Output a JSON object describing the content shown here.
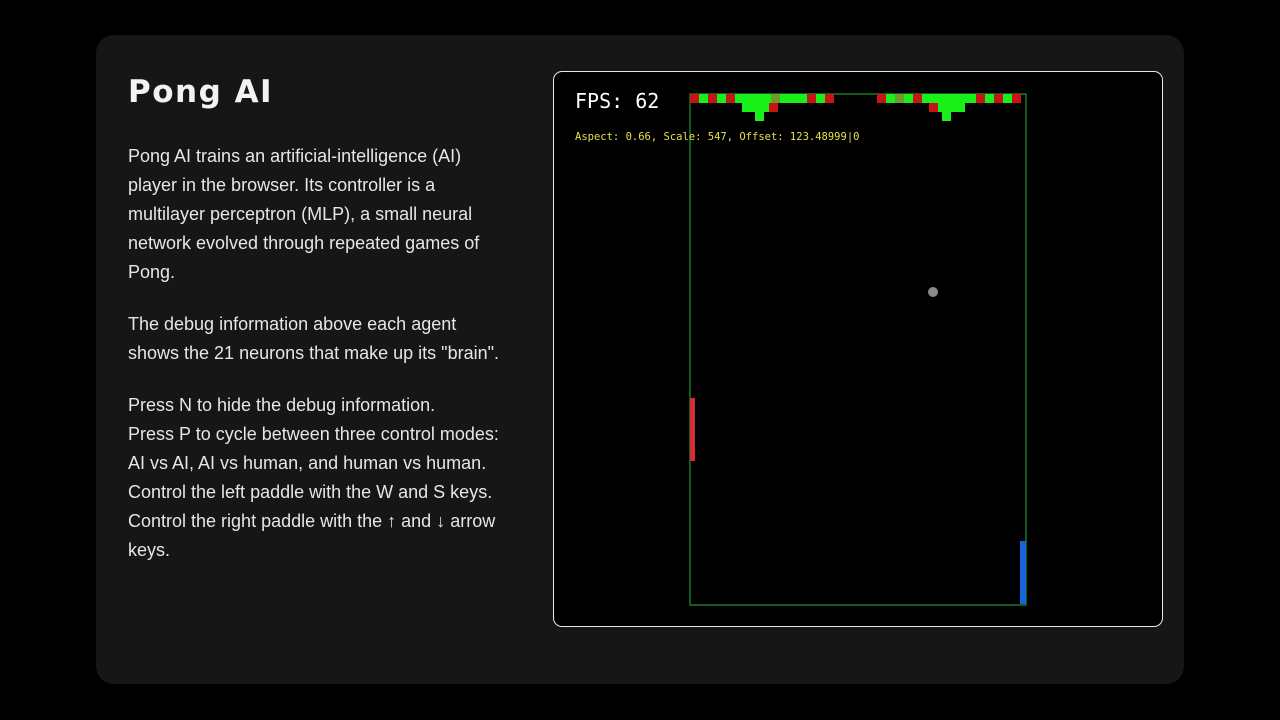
{
  "title": "Pong AI",
  "paragraphs": {
    "intro": "Pong AI trains an artificial-intelligence (AI) player in the browser. Its controller is a multilayer perceptron (MLP), a small neural network evolved through repeated games of Pong.",
    "debug": "The debug information above each agent shows the 21 neurons that make up its \"brain\".",
    "controls": [
      "Press N to hide the debug information.",
      "Press P to cycle between three control modes: AI vs AI, AI vs human, and human vs human.",
      "Control the left paddle with the W and S keys.",
      "Control the right paddle with the ↑ and ↓ arrow keys."
    ]
  },
  "game": {
    "fps_label": "FPS: 62",
    "debug_line": "Aspect: 0.66, Scale: 547, Offset: 123.48999|0",
    "left_paddle": {
      "color": "#d62b35",
      "position": 0.55
    },
    "right_paddle": {
      "color": "#1565d8",
      "position": 0.9
    },
    "ball": {
      "color": "#8a8a8a"
    },
    "court_border_color": "#1f9a3a",
    "neuron_colors": {
      "active": "#19f019",
      "inactive": "#c81414",
      "neutral": "#6f9a2c"
    }
  }
}
